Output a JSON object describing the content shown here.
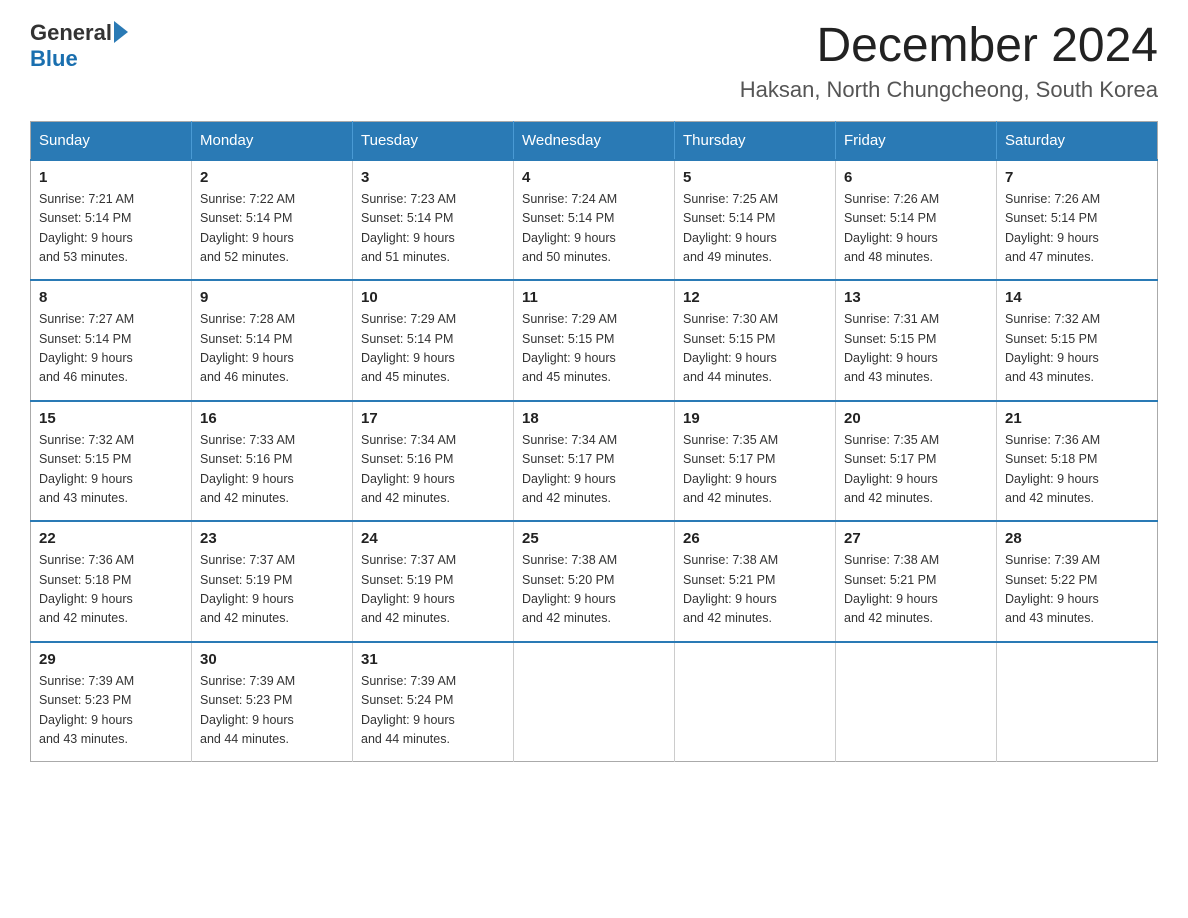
{
  "header": {
    "logo_general": "General",
    "logo_blue": "Blue",
    "month_year": "December 2024",
    "location": "Haksan, North Chungcheong, South Korea"
  },
  "days_of_week": [
    "Sunday",
    "Monday",
    "Tuesday",
    "Wednesday",
    "Thursday",
    "Friday",
    "Saturday"
  ],
  "weeks": [
    [
      {
        "day": "1",
        "sunrise": "7:21 AM",
        "sunset": "5:14 PM",
        "daylight": "9 hours and 53 minutes."
      },
      {
        "day": "2",
        "sunrise": "7:22 AM",
        "sunset": "5:14 PM",
        "daylight": "9 hours and 52 minutes."
      },
      {
        "day": "3",
        "sunrise": "7:23 AM",
        "sunset": "5:14 PM",
        "daylight": "9 hours and 51 minutes."
      },
      {
        "day": "4",
        "sunrise": "7:24 AM",
        "sunset": "5:14 PM",
        "daylight": "9 hours and 50 minutes."
      },
      {
        "day": "5",
        "sunrise": "7:25 AM",
        "sunset": "5:14 PM",
        "daylight": "9 hours and 49 minutes."
      },
      {
        "day": "6",
        "sunrise": "7:26 AM",
        "sunset": "5:14 PM",
        "daylight": "9 hours and 48 minutes."
      },
      {
        "day": "7",
        "sunrise": "7:26 AM",
        "sunset": "5:14 PM",
        "daylight": "9 hours and 47 minutes."
      }
    ],
    [
      {
        "day": "8",
        "sunrise": "7:27 AM",
        "sunset": "5:14 PM",
        "daylight": "9 hours and 46 minutes."
      },
      {
        "day": "9",
        "sunrise": "7:28 AM",
        "sunset": "5:14 PM",
        "daylight": "9 hours and 46 minutes."
      },
      {
        "day": "10",
        "sunrise": "7:29 AM",
        "sunset": "5:14 PM",
        "daylight": "9 hours and 45 minutes."
      },
      {
        "day": "11",
        "sunrise": "7:29 AM",
        "sunset": "5:15 PM",
        "daylight": "9 hours and 45 minutes."
      },
      {
        "day": "12",
        "sunrise": "7:30 AM",
        "sunset": "5:15 PM",
        "daylight": "9 hours and 44 minutes."
      },
      {
        "day": "13",
        "sunrise": "7:31 AM",
        "sunset": "5:15 PM",
        "daylight": "9 hours and 43 minutes."
      },
      {
        "day": "14",
        "sunrise": "7:32 AM",
        "sunset": "5:15 PM",
        "daylight": "9 hours and 43 minutes."
      }
    ],
    [
      {
        "day": "15",
        "sunrise": "7:32 AM",
        "sunset": "5:15 PM",
        "daylight": "9 hours and 43 minutes."
      },
      {
        "day": "16",
        "sunrise": "7:33 AM",
        "sunset": "5:16 PM",
        "daylight": "9 hours and 42 minutes."
      },
      {
        "day": "17",
        "sunrise": "7:34 AM",
        "sunset": "5:16 PM",
        "daylight": "9 hours and 42 minutes."
      },
      {
        "day": "18",
        "sunrise": "7:34 AM",
        "sunset": "5:17 PM",
        "daylight": "9 hours and 42 minutes."
      },
      {
        "day": "19",
        "sunrise": "7:35 AM",
        "sunset": "5:17 PM",
        "daylight": "9 hours and 42 minutes."
      },
      {
        "day": "20",
        "sunrise": "7:35 AM",
        "sunset": "5:17 PM",
        "daylight": "9 hours and 42 minutes."
      },
      {
        "day": "21",
        "sunrise": "7:36 AM",
        "sunset": "5:18 PM",
        "daylight": "9 hours and 42 minutes."
      }
    ],
    [
      {
        "day": "22",
        "sunrise": "7:36 AM",
        "sunset": "5:18 PM",
        "daylight": "9 hours and 42 minutes."
      },
      {
        "day": "23",
        "sunrise": "7:37 AM",
        "sunset": "5:19 PM",
        "daylight": "9 hours and 42 minutes."
      },
      {
        "day": "24",
        "sunrise": "7:37 AM",
        "sunset": "5:19 PM",
        "daylight": "9 hours and 42 minutes."
      },
      {
        "day": "25",
        "sunrise": "7:38 AM",
        "sunset": "5:20 PM",
        "daylight": "9 hours and 42 minutes."
      },
      {
        "day": "26",
        "sunrise": "7:38 AM",
        "sunset": "5:21 PM",
        "daylight": "9 hours and 42 minutes."
      },
      {
        "day": "27",
        "sunrise": "7:38 AM",
        "sunset": "5:21 PM",
        "daylight": "9 hours and 42 minutes."
      },
      {
        "day": "28",
        "sunrise": "7:39 AM",
        "sunset": "5:22 PM",
        "daylight": "9 hours and 43 minutes."
      }
    ],
    [
      {
        "day": "29",
        "sunrise": "7:39 AM",
        "sunset": "5:23 PM",
        "daylight": "9 hours and 43 minutes."
      },
      {
        "day": "30",
        "sunrise": "7:39 AM",
        "sunset": "5:23 PM",
        "daylight": "9 hours and 44 minutes."
      },
      {
        "day": "31",
        "sunrise": "7:39 AM",
        "sunset": "5:24 PM",
        "daylight": "9 hours and 44 minutes."
      },
      null,
      null,
      null,
      null
    ]
  ],
  "labels": {
    "sunrise": "Sunrise:",
    "sunset": "Sunset:",
    "daylight": "Daylight:"
  }
}
